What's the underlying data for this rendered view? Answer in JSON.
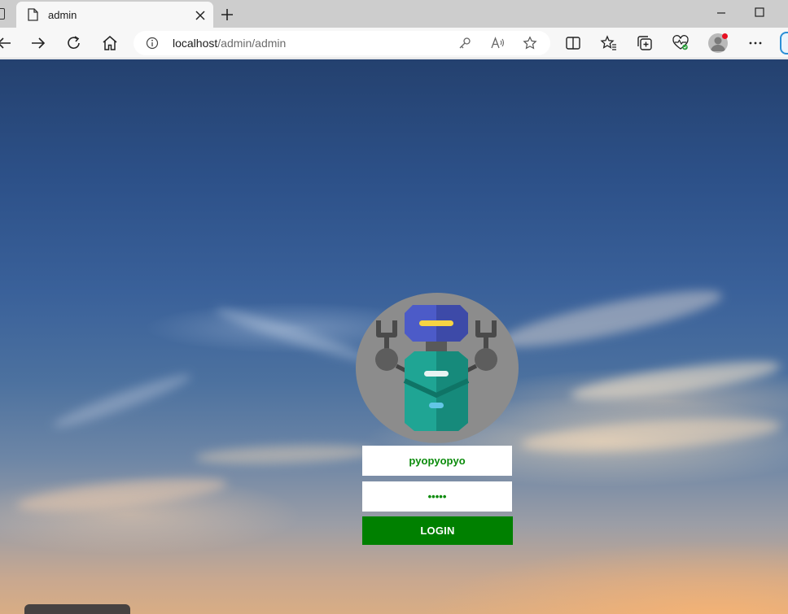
{
  "browser": {
    "tab": {
      "title": "admin",
      "favicon": "page-icon",
      "close": "close-icon"
    },
    "new_tab": "plus-icon",
    "window_controls": [
      "minimize-icon",
      "maximize-icon"
    ],
    "nav": [
      "back-icon",
      "forward-icon",
      "refresh-icon",
      "home-icon"
    ],
    "address": {
      "host": "localhost",
      "path": "/admin/admin",
      "info_icon": "info-icon"
    },
    "address_actions": [
      "key-icon",
      "read-aloud-icon",
      "star-icon"
    ],
    "toolbar_actions": [
      "split-screen-icon",
      "favorites-icon",
      "collections-icon",
      "performance-icon",
      "profile-avatar",
      "more-icon",
      "copilot-icon"
    ]
  },
  "login": {
    "username_value": "pyopyopyo",
    "password_value": "•••••",
    "button_label": "LOGIN",
    "logo": "robot-icon"
  },
  "colors": {
    "button": "#008000",
    "field_text": "#0b8b0b",
    "robot_bg": "#8c8c8c",
    "robot_head": "#4c5bc8",
    "robot_body": "#1fa594"
  }
}
